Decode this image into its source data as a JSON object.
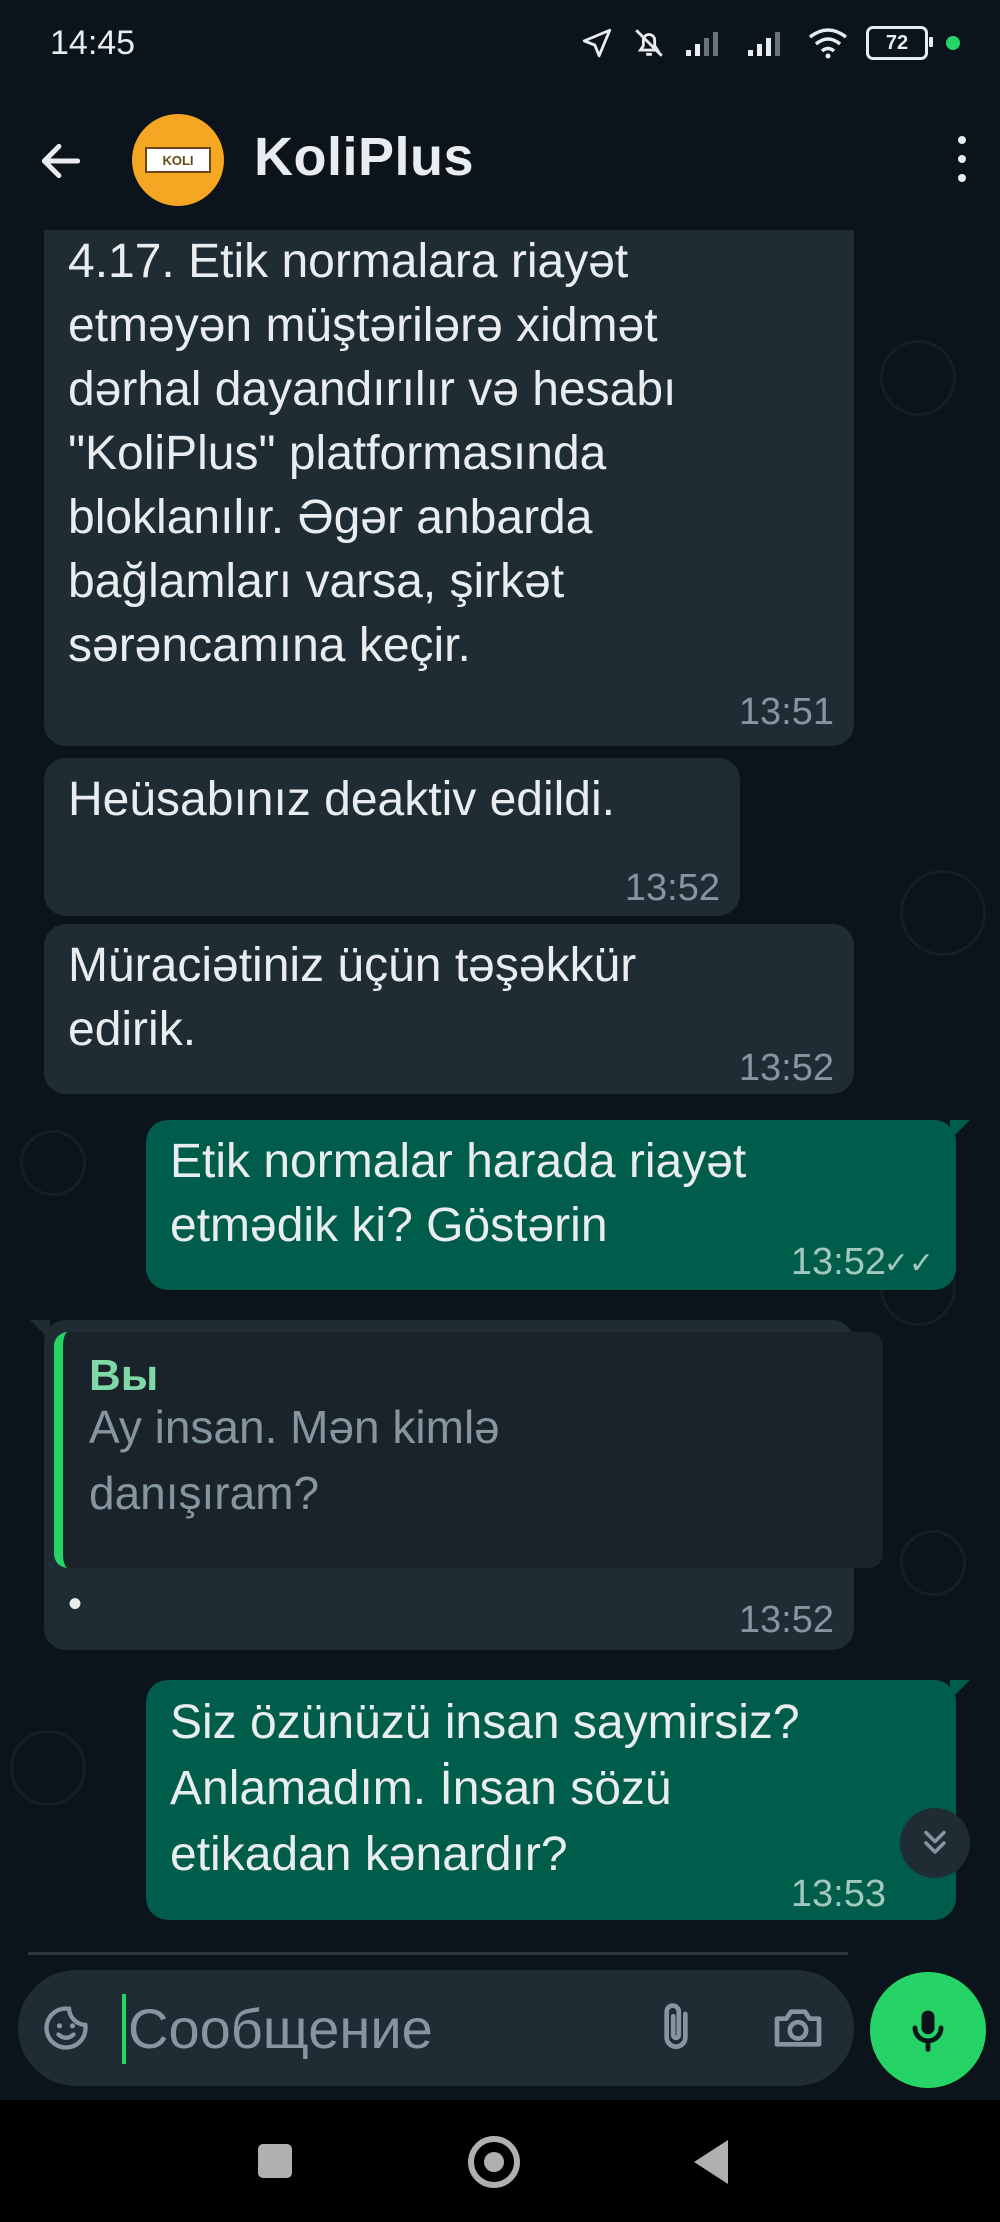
{
  "status_bar": {
    "time": "14:45",
    "battery": "72"
  },
  "header": {
    "contact_name": "KoliPlus",
    "avatar_text": "KOLI"
  },
  "messages": [
    {
      "direction": "in",
      "text": "4.17. Etik normalara riayət\netməyən müştərilərə xidmət\ndərhal dayandırılır və hesabı\n\"KoliPlus\" platformasında\nbloklanılır. Əgər anbarda\nbağlamları varsa, şirkət\nsərəncamına keçir.",
      "time": "13:51"
    },
    {
      "direction": "in",
      "text": "Heüsabınız deaktiv edildi.",
      "time": "13:52"
    },
    {
      "direction": "in",
      "text": "Müraciətiniz üçün təşəkkür\nedirik.",
      "time": "13:52"
    },
    {
      "direction": "out",
      "text": "Etik normalar harada riayət\netmədik ki? Göstərin",
      "time": "13:52"
    },
    {
      "direction": "in",
      "quote_author": "Вы",
      "quote_text": "Ay insan. Mən kimlə\ndanışıram?",
      "text": "•",
      "time": "13:52"
    },
    {
      "direction": "out",
      "text": "Siz özünüzü insan saymirsiz?\nAnlamadım. İnsan sözü\netikadan kənardır?",
      "time": "13:53"
    }
  ],
  "composer": {
    "placeholder": "Сообщение"
  },
  "icons": {
    "back": "arrow-left-icon",
    "menu": "more-vert-icon",
    "emoji": "sticker-icon",
    "attach": "paperclip-icon",
    "camera": "camera-icon",
    "mic": "microphone-icon",
    "scroll": "double-chevron-down-icon"
  },
  "colors": {
    "background": "#0b141a",
    "incoming": "#202c33",
    "outgoing": "#005c4b",
    "accent": "#25d366",
    "avatar": "#f5a623"
  }
}
